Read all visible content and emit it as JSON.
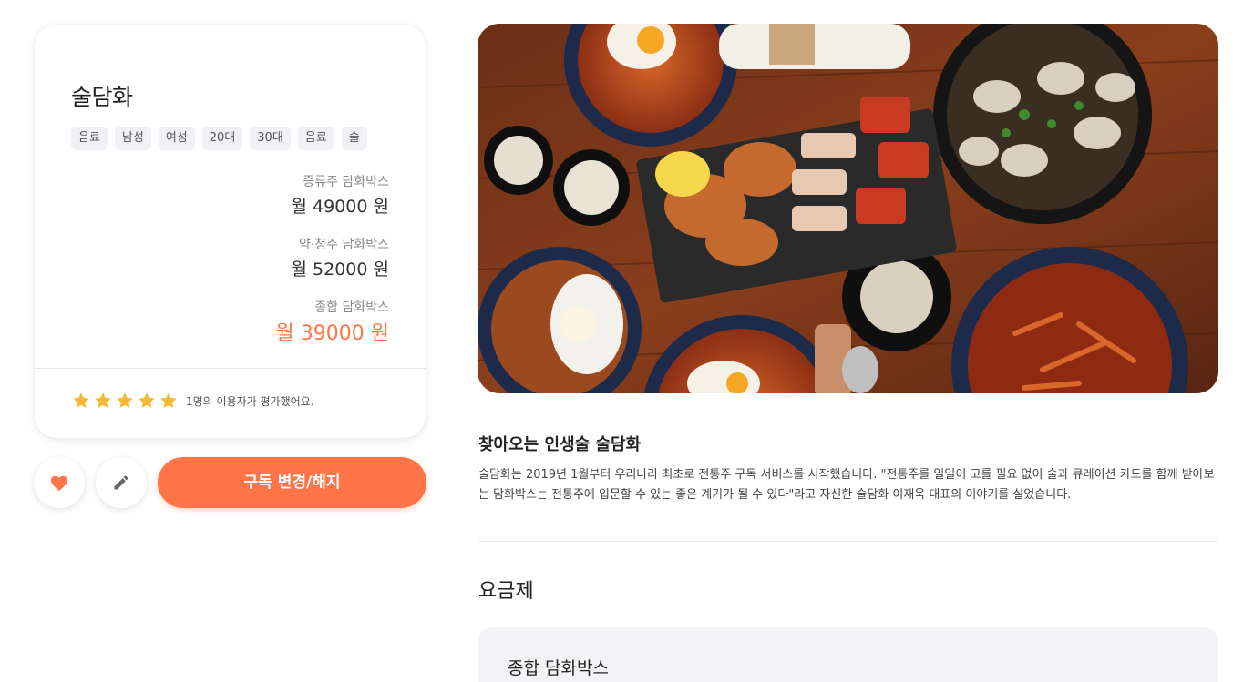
{
  "product": {
    "title": "술담화",
    "tags": [
      "음료",
      "남성",
      "여성",
      "20대",
      "30대",
      "음료",
      "술"
    ],
    "plans": [
      {
        "name": "증류주 담화박스",
        "price": "월 49000 원"
      },
      {
        "name": "약·청주 담화박스",
        "price": "월 52000 원"
      },
      {
        "name": "종합 담화박스",
        "price": "월 39000 원"
      }
    ],
    "rating": {
      "stars": 5,
      "max": 5,
      "text": "1명의 이용자가 평가했어요."
    }
  },
  "actions": {
    "heart_icon": "heart-icon",
    "edit_icon": "pencil-icon",
    "subscribe_label": "구독 변경/해지"
  },
  "detail": {
    "title": "찾아오는 인생술 술담화",
    "description": "술담화는 2019년 1월부터 우리나라 최초로 전통주 구독 서비스를 시작했습니다. \"전통주를 일일이 고를 필요 없이 술과 큐레이션 카드를 함께 받아보는 담화박스는 전통주에 입문할 수 있는 좋은 계기가 될 수 있다\"라고 자신한 술담화 이재욱 대표의 이야기를 실었습니다."
  },
  "pricing": {
    "heading": "요금제",
    "first_plan_title": "종합 담화박스"
  },
  "colors": {
    "accent": "#ff7548",
    "star": "#f7b934",
    "tag_bg": "#f1f1f5"
  }
}
